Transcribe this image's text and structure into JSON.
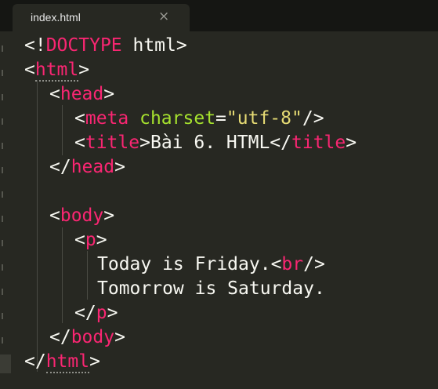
{
  "tab": {
    "filename": "index.html",
    "close_glyph": "×"
  },
  "code": {
    "doctype_open": "<!",
    "doctype_kw": "DOCTYPE",
    "doctype_rest": " html>",
    "lt": "<",
    "gt": ">",
    "slash_lt": "</",
    "self_close": "/>",
    "eq": "=",
    "tag_html": "html",
    "tag_head": "head",
    "tag_meta": "meta",
    "attr_charset": "charset",
    "str_charset": "\"utf-8\"",
    "tag_title": "title",
    "title_text": "Bài 6. HTML",
    "tag_body": "body",
    "tag_p": "p",
    "text_line1": "Today is Friday.",
    "tag_br": "br",
    "text_line2": "Tomorrow is Saturday."
  },
  "colors": {
    "background": "#272822",
    "tag": "#f92672",
    "attribute": "#a6e22e",
    "string": "#e6db74",
    "text": "#f8f8f2"
  }
}
